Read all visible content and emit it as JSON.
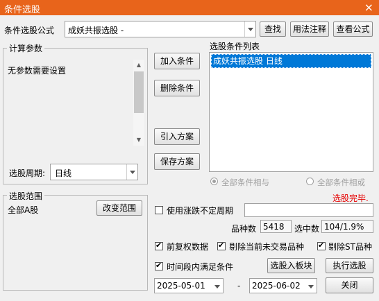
{
  "window": {
    "title": "条件选股",
    "close_glyph": "×"
  },
  "formula": {
    "label": "条件选股公式",
    "value": "成妖共振选股  -"
  },
  "top_buttons": {
    "find": "查找",
    "usage": "用法注释",
    "view": "查看公式"
  },
  "params": {
    "group_label": "计算参数",
    "empty_text": "无参数需要设置",
    "period_label": "选股周期:",
    "period_value": "日线"
  },
  "middle_buttons": {
    "add": "加入条件",
    "remove": "删除条件",
    "import": "引入方案",
    "save": "保存方案"
  },
  "condition_list": {
    "label": "选股条件列表",
    "items": [
      "成妖共振选股  日线"
    ]
  },
  "logic": {
    "and_label": "全部条件相与",
    "or_label": "全部条件相或",
    "and_checked": true,
    "or_checked": false
  },
  "status": {
    "text": "选股完毕.",
    "color": "#e60000"
  },
  "range": {
    "group_label": "选股范围",
    "value": "全部A股",
    "change_button": "改变范围"
  },
  "uncertain_period": {
    "label": "使用涨跌不定周期",
    "checked": false,
    "value": ""
  },
  "stats": {
    "count_label": "品种数",
    "count_value": "5418",
    "selected_label": "选中数",
    "selected_value": "104/1.9%"
  },
  "options": {
    "forward_adjust": {
      "label": "前复权数据",
      "checked": true
    },
    "exclude_untraded": {
      "label": "剔除当前未交易品种",
      "checked": true
    },
    "exclude_st": {
      "label": "剔除ST品种",
      "checked": true
    },
    "time_range": {
      "label": "时间段内满足条件",
      "checked": true
    }
  },
  "actions": {
    "to_block": "选股入板块",
    "execute": "执行选股",
    "close": "关闭"
  },
  "dates": {
    "start": "2025-05-01",
    "separator": "-",
    "end": "2025-06-02"
  },
  "accent_color": "#e8641b",
  "selection_color": "#0078d7"
}
